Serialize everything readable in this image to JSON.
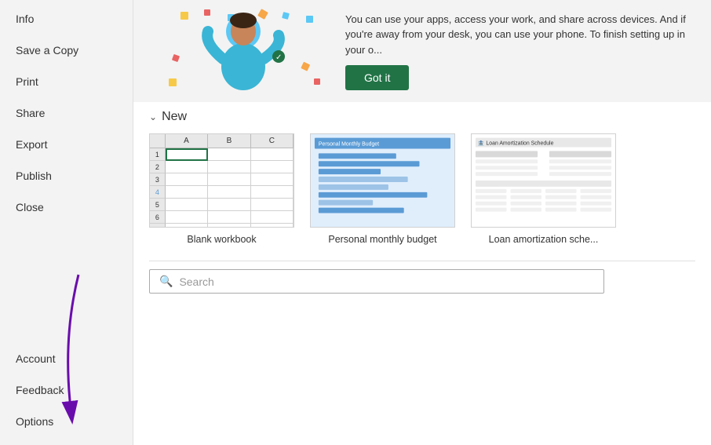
{
  "sidebar": {
    "items_top": [
      {
        "id": "info",
        "label": "Info"
      },
      {
        "id": "save-copy",
        "label": "Save a Copy"
      },
      {
        "id": "print",
        "label": "Print"
      },
      {
        "id": "share",
        "label": "Share"
      },
      {
        "id": "export",
        "label": "Export"
      },
      {
        "id": "publish",
        "label": "Publish"
      },
      {
        "id": "close",
        "label": "Close"
      }
    ],
    "items_bottom": [
      {
        "id": "account",
        "label": "Account"
      },
      {
        "id": "feedback",
        "label": "Feedback"
      },
      {
        "id": "options",
        "label": "Options"
      }
    ]
  },
  "banner": {
    "text": "You can use your apps, access your work, and share across devices. And if you're away from your desk, you can use your phone. To finish setting up in your o...",
    "button_label": "Got it"
  },
  "new_section": {
    "title": "New",
    "templates": [
      {
        "id": "blank",
        "label": "Blank workbook"
      },
      {
        "id": "budget",
        "label": "Personal monthly budget"
      },
      {
        "id": "loan",
        "label": "Loan amortization sche..."
      }
    ]
  },
  "search": {
    "placeholder": "Search"
  },
  "colors": {
    "sidebar_bg": "#f3f3f3",
    "accent_green": "#217346",
    "sidebar_active": "#e8e8e8"
  }
}
